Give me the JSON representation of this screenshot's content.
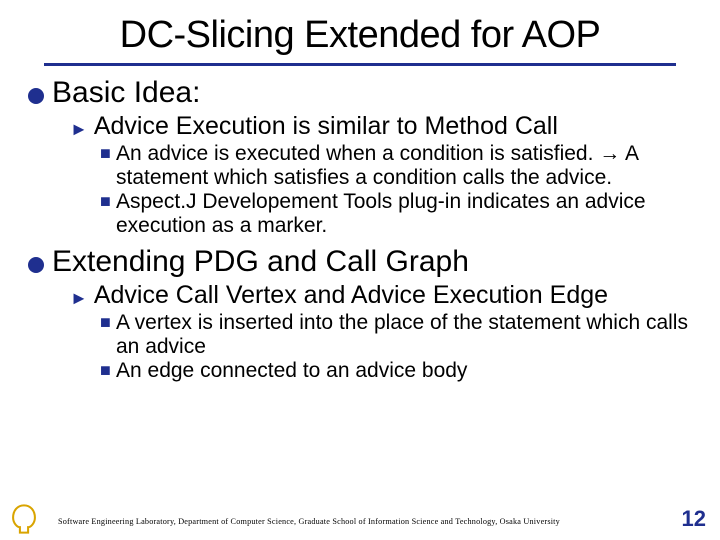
{
  "title": "DC-Slicing Extended for AOP",
  "sections": [
    {
      "heading": "Basic Idea:",
      "sub": {
        "heading": "Advice Execution is similar to Method Call",
        "points": [
          "An advice is executed when a condition is satisfied. → A statement which satisfies a condition calls the advice.",
          "Aspect.J Developement Tools plug-in indicates an advice execution as a marker."
        ]
      }
    },
    {
      "heading": "Extending PDG and Call Graph",
      "sub": {
        "heading": "Advice Call Vertex and Advice Execution Edge",
        "points": [
          "A vertex is inserted into the place of the statement which calls an advice",
          "An edge connected to an advice body"
        ]
      }
    }
  ],
  "footer": "Software Engineering Laboratory, Department of Computer Science, Graduate School of Information Science and Technology, Osaka University",
  "page": "12"
}
